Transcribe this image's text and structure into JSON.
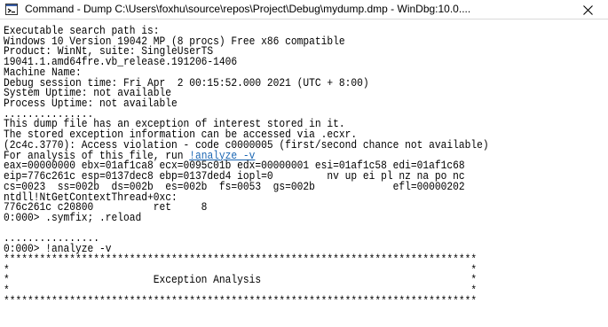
{
  "window": {
    "title": "Command - Dump C:\\Users\\foxhu\\source\\repos\\Project\\Debug\\mydump.dmp - WinDbg:10.0...."
  },
  "icons": {
    "app": "windbg-app-icon",
    "close": "close-icon"
  },
  "colors": {
    "link": "#1a66b3",
    "text": "#000000",
    "background": "#ffffff"
  },
  "console": {
    "lines": [
      "Executable search path is:",
      "Windows 10 Version 19042 MP (8 procs) Free x86 compatible",
      "Product: WinNt, suite: SingleUserTS",
      "19041.1.amd64fre.vb_release.191206-1406",
      "Machine Name:",
      "Debug session time: Fri Apr  2 00:15:52.000 2021 (UTC + 8:00)",
      "System Uptime: not available",
      "Process Uptime: not available",
      "...............",
      "This dump file has an exception of interest stored in it.",
      "The stored exception information can be accessed via .ecxr.",
      "(2c4c.3770): Access violation - code c0000005 (first/second chance not available)"
    ],
    "analyze_prefix": "For analysis of this file, run ",
    "analyze_link": "!analyze -v",
    "lines_after": [
      "eax=00000000 ebx=01af1ca8 ecx=0095c01b edx=00000001 esi=01af1c58 edi=01af1c68",
      "eip=776c261c esp=0137dec8 ebp=0137ded4 iopl=0         nv up ei pl nz na po nc",
      "cs=0023  ss=002b  ds=002b  es=002b  fs=0053  gs=002b             efl=00000202",
      "ntdll!NtGetContextThread+0xc:",
      "776c261c c20800          ret     8",
      "0:000> .symfix; .reload",
      "",
      "0:000> !analyze -v",
      "*******************************************************************************",
      "*                                                                             *",
      "*                        Exception Analysis                                   *",
      "*                                                                             *",
      "*******************************************************************************"
    ],
    "reload_dots": "................"
  }
}
